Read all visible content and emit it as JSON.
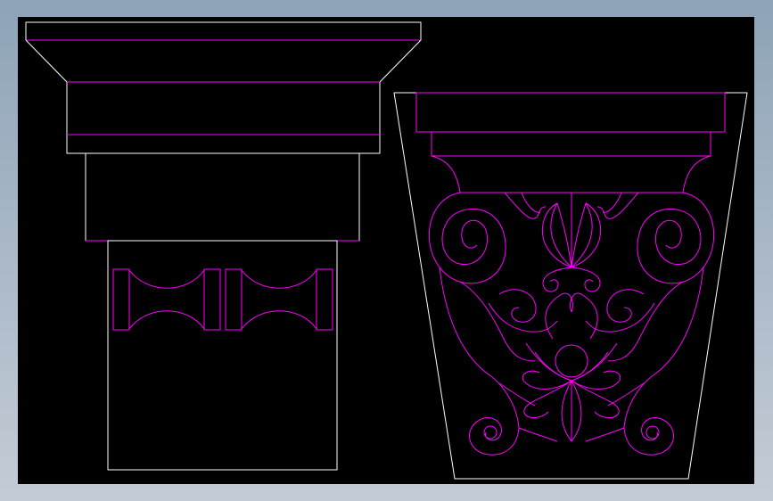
{
  "colors": {
    "background_frame": "#9fb0c2",
    "canvas": "#000000",
    "outline": "#ffffff",
    "detail": "#ff00ff"
  },
  "views": [
    {
      "id": "elevation",
      "icon": "column-capital-elevation"
    },
    {
      "id": "carved-face",
      "icon": "column-capital-carved-face"
    }
  ]
}
